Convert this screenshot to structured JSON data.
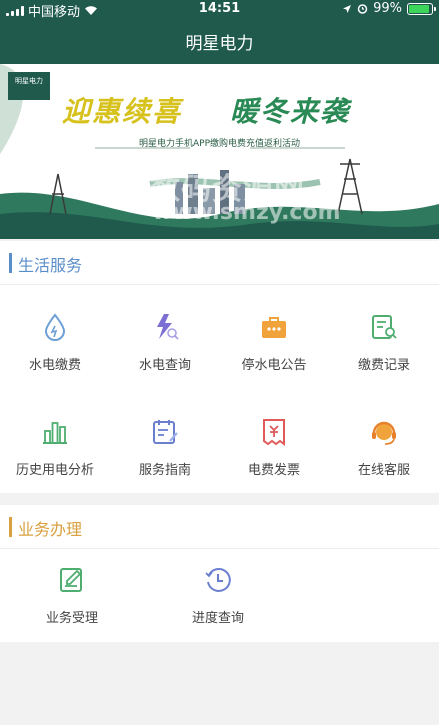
{
  "status_bar": {
    "carrier": "中国移动",
    "time": "14:51",
    "battery": "99%"
  },
  "header": {
    "title": "明星电力"
  },
  "banner": {
    "logo_text": "明星电力",
    "calligraphy_left": "迎惠续喜",
    "calligraphy_right": "暖冬来袭",
    "subtitle": "明星电力手机APP缴购电费充值返利活动",
    "watermark": "数码资源网",
    "watermark_url": "www.smzy.com"
  },
  "life_services": {
    "title": "生活服务",
    "items": [
      {
        "label": "水电缴费",
        "icon": "water-drop-icon"
      },
      {
        "label": "水电查询",
        "icon": "lightning-search-icon"
      },
      {
        "label": "停水电公告",
        "icon": "briefcase-icon"
      },
      {
        "label": "缴费记录",
        "icon": "record-search-icon"
      },
      {
        "label": "历史用电分析",
        "icon": "bar-chart-icon"
      },
      {
        "label": "服务指南",
        "icon": "guide-icon"
      },
      {
        "label": "电费发票",
        "icon": "invoice-icon"
      },
      {
        "label": "在线客服",
        "icon": "headset-icon"
      }
    ]
  },
  "business": {
    "title": "业务办理",
    "items": [
      {
        "label": "业务受理",
        "icon": "edit-form-icon"
      },
      {
        "label": "进度查询",
        "icon": "clock-icon"
      }
    ]
  },
  "colors": {
    "header": "#1f5a4d",
    "life_accent": "#5b8ec9",
    "business_accent": "#d9a040"
  }
}
